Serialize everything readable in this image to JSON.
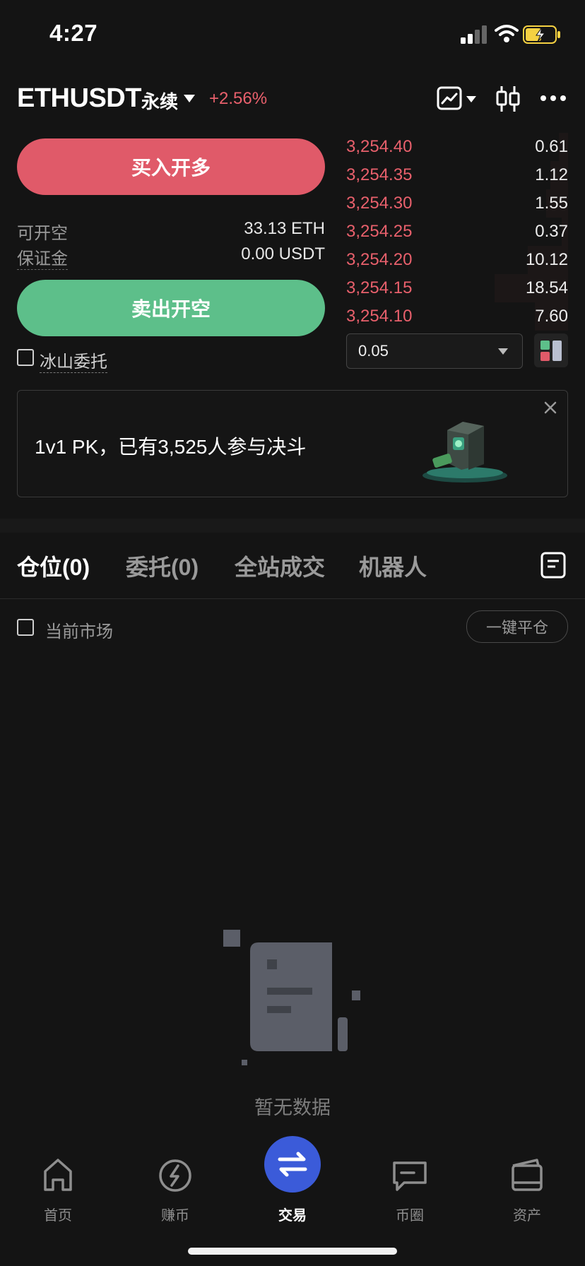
{
  "status_bar": {
    "time": "4:27"
  },
  "header": {
    "symbol": "ETHUSDT",
    "contract": "永续",
    "change": "+2.56%"
  },
  "trade": {
    "buy_label": "买入开多",
    "sell_label": "卖出开空",
    "available_label": "可开空",
    "available_value": "33.13 ETH",
    "margin_label": "保证金",
    "margin_value": "0.00 USDT",
    "iceberg_label": "冰山委托"
  },
  "order_book": {
    "rows": [
      {
        "price": "3,254.40",
        "qty": "0.61",
        "depth": 0.04
      },
      {
        "price": "3,254.35",
        "qty": "1.12",
        "depth": 0.08
      },
      {
        "price": "3,254.30",
        "qty": "1.55",
        "depth": 0.1
      },
      {
        "price": "3,254.25",
        "qty": "0.37",
        "depth": 0.03
      },
      {
        "price": "3,254.20",
        "qty": "10.12",
        "depth": 0.18
      },
      {
        "price": "3,254.15",
        "qty": "18.54",
        "depth": 0.33
      },
      {
        "price": "3,254.10",
        "qty": "7.60",
        "depth": 0.15
      }
    ],
    "precision": "0.05"
  },
  "banner": {
    "text": "1v1 PK，已有3,525人参与决斗"
  },
  "tabs": [
    {
      "label": "仓位(0)",
      "active": true
    },
    {
      "label": "委托(0)",
      "active": false
    },
    {
      "label": "全站成交",
      "active": false
    },
    {
      "label": "机器人",
      "active": false
    }
  ],
  "filter": {
    "current_market_label": "当前市场",
    "close_all_label": "一键平仓"
  },
  "empty_state": {
    "text": "暂无数据"
  },
  "bottom_nav": [
    {
      "label": "首页",
      "icon": "home-icon"
    },
    {
      "label": "赚币",
      "icon": "earn-icon"
    },
    {
      "label": "交易",
      "icon": "trade-swap-icon",
      "active": true
    },
    {
      "label": "币圈",
      "icon": "community-chat-icon"
    },
    {
      "label": "资产",
      "icon": "wallet-icon"
    }
  ],
  "colors": {
    "buy": "#e05a69",
    "sell": "#5dbf8a",
    "trade_active": "#3b5bd9",
    "price_red": "#e8606c"
  }
}
